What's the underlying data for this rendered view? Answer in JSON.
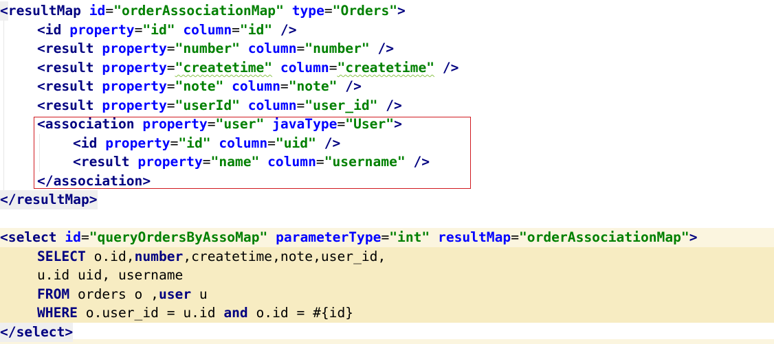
{
  "code": {
    "resultmap_open": {
      "lt": "<",
      "tag": "resultMap",
      "a1": "id",
      "v1": "\"orderAssociationMap\"",
      "a2": "type",
      "v2": "\"Orders\"",
      "gt": ">"
    },
    "id_line": {
      "tag": "<id",
      "a1": "property",
      "v1": "\"id\"",
      "a2": "column",
      "v2": "\"id\"",
      "end": " />"
    },
    "result_number": {
      "tag": "<result",
      "a1": "property",
      "v1": "\"number\"",
      "a2": "column",
      "v2": "\"number\"",
      "end": " />"
    },
    "result_createtime": {
      "tag": "<result",
      "a1": "property",
      "v1": "\"createtime\"",
      "a2": "column",
      "v2": "\"createtime\"",
      "end": " />"
    },
    "result_note": {
      "tag": "<result",
      "a1": "property",
      "v1": "\"note\"",
      "a2": "column",
      "v2": "\"note\"",
      "end": " />"
    },
    "result_userid": {
      "tag": "<result",
      "a1": "property",
      "v1": "\"userId\"",
      "a2": "column",
      "v2": "\"user_id\"",
      "end": " />"
    },
    "association_open": {
      "tag": "<association",
      "a1": "property",
      "v1": "\"user\"",
      "a2": "javaType",
      "v2": "\"User\"",
      "end": ">"
    },
    "assoc_id": {
      "tag": "<id",
      "a1": "property",
      "v1": "\"id\"",
      "a2": "column",
      "v2": "\"uid\"",
      "end": " />"
    },
    "assoc_result": {
      "tag": "<result",
      "a1": "property",
      "v1": "\"name\"",
      "a2": "column",
      "v2": "\"username\"",
      "end": " />"
    },
    "association_close": "</association>",
    "resultmap_close": "</resultMap>",
    "select_open": {
      "tag": "<select",
      "a1": "id",
      "v1": "\"queryOrdersByAssoMap\"",
      "a2": "parameterType",
      "v2": "\"int\"",
      "a3": "resultMap",
      "v3": "\"orderAssociationMap\"",
      "end": ">"
    },
    "sql1": {
      "kw": "SELECT",
      "t1": " o.id,",
      "kw2": "number",
      "t2": ",createtime,note,user_id,"
    },
    "sql2": {
      "t1": "u.id uid, username"
    },
    "sql3": {
      "kw": "FROM",
      "t1": " orders o ,",
      "kw2": "user",
      "t2": " u"
    },
    "sql4": {
      "kw": "WHERE",
      "t1": " o.user_id = u.id ",
      "kw2": "and",
      "t2": " o.id = #{id}"
    },
    "select_close": "</select>"
  }
}
